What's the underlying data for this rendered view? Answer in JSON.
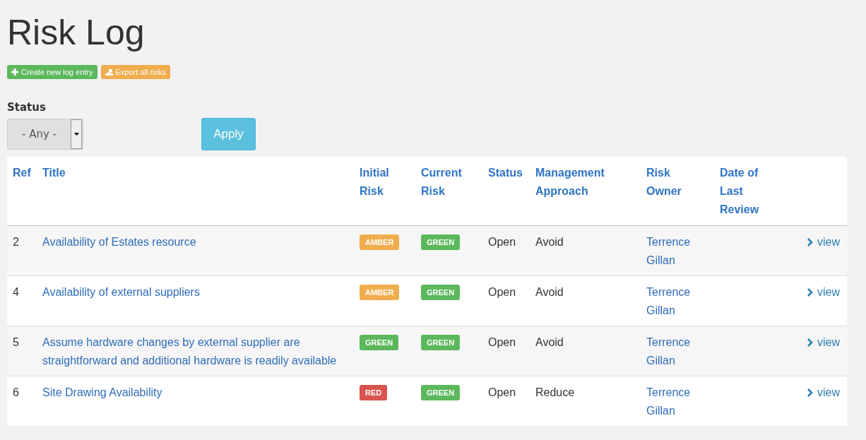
{
  "page_title": "Risk Log",
  "actions": [
    {
      "kind": "create",
      "label": "Create new log entry"
    },
    {
      "kind": "export",
      "label": "Export all risks"
    }
  ],
  "filter": {
    "label": "Status",
    "value": "- Any -",
    "apply": "Apply"
  },
  "table": {
    "columns": [
      "Ref",
      "Title",
      "Initial Risk",
      "Current Risk",
      "Status",
      "Management Approach",
      "Risk Owner",
      "Date of Last Review"
    ],
    "rows": [
      {
        "ref": "2",
        "title": "Availability of Estates resource",
        "initial": {
          "label": "AMBER",
          "color": "#f0ad4e"
        },
        "current": {
          "label": "GREEN",
          "color": "#5cb85c"
        },
        "status": "Open",
        "approach": "Avoid",
        "owner": "Terrence Gillan",
        "link": "view"
      },
      {
        "ref": "4",
        "title": "Availability of external suppliers",
        "initial": {
          "label": "AMBER",
          "color": "#f0ad4e"
        },
        "current": {
          "label": "GREEN",
          "color": "#5cb85c"
        },
        "status": "Open",
        "approach": "Avoid",
        "owner": "Terrence Gillan",
        "link": "view"
      },
      {
        "ref": "5",
        "title": "Assume hardware changes by external supplier are straightforward and additional hardware is readily available",
        "initial": {
          "label": "GREEN",
          "color": "#5cb85c"
        },
        "current": {
          "label": "GREEN",
          "color": "#5cb85c"
        },
        "status": "Open",
        "approach": "Avoid",
        "owner": "Terrence Gillan",
        "link": "view"
      },
      {
        "ref": "6",
        "title": "Site Drawing Availability",
        "initial": {
          "label": "RED",
          "color": "#d9534f"
        },
        "current": {
          "label": "GREEN",
          "color": "#5cb85c"
        },
        "status": "Open",
        "approach": "Reduce",
        "owner": "Terrence Gillan",
        "link": "view"
      }
    ]
  }
}
